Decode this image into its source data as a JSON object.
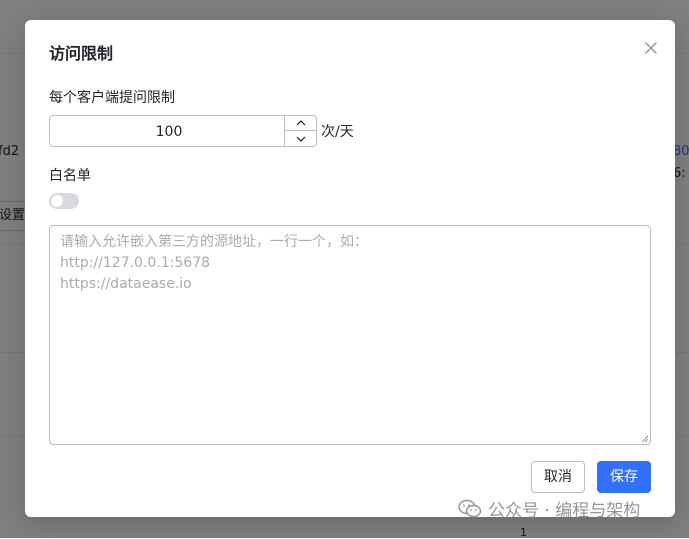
{
  "background": {
    "row_text_left": "fd2",
    "row_text_right_link": "80",
    "row_text_right": "6:",
    "settings_button": "设置",
    "page_number": "1"
  },
  "dialog": {
    "title": "访问限制",
    "per_client_label": "每个客户端提问限制",
    "per_client_value": "100",
    "unit": "次/天",
    "whitelist_label": "白名单",
    "whitelist_enabled": false,
    "whitelist_placeholder": "请输入允许嵌入第三方的源地址，一行一个，如：\nhttp://127.0.0.1:5678\nhttps://dataease.io",
    "cancel_label": "取消",
    "save_label": "保存"
  },
  "watermark": {
    "text": "公众号 · 编程与架构"
  },
  "colors": {
    "primary": "#3370ff",
    "overlay": "rgba(0,0,0,0.5)",
    "toggle_off": "#d7d9dc"
  }
}
